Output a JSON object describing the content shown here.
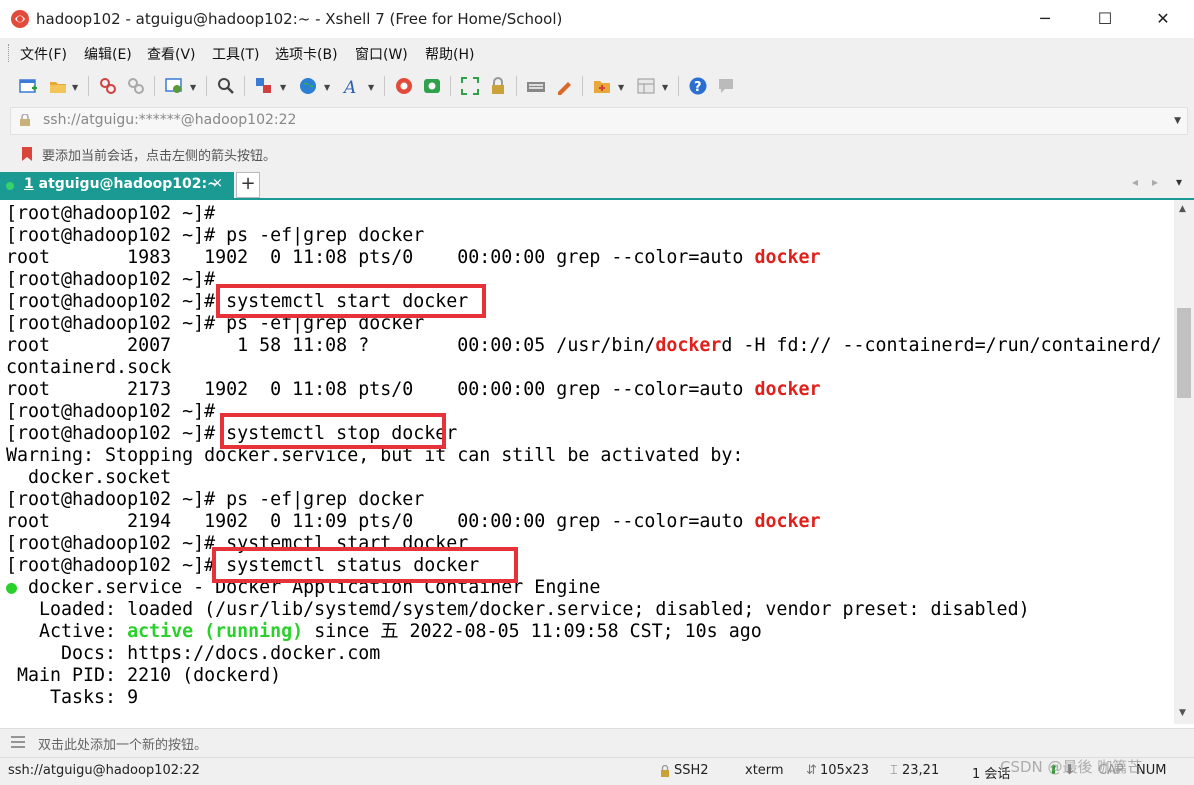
{
  "window": {
    "title": "hadoop102 - atguigu@hadoop102:~ - Xshell 7 (Free for Home/School)",
    "minimize": "─",
    "maximize": "☐",
    "close": "✕"
  },
  "menu": [
    "文件(F)",
    "编辑(E)",
    "查看(V)",
    "工具(T)",
    "选项卡(B)",
    "窗口(W)",
    "帮助(H)"
  ],
  "address": {
    "value": "ssh://atguigu:******@hadoop102:22"
  },
  "hint": "要添加当前会话，点击左侧的箭头按钮。",
  "tab": {
    "number": "1",
    "label": " atguigu@hadoop102:~",
    "close": "×",
    "add": "+",
    "nav_left": "◂",
    "nav_right": "▸",
    "nav_menu": "▾"
  },
  "terminal": {
    "lines": [
      [
        "[root@hadoop102 ~]#"
      ],
      [
        "[root@hadoop102 ~]# ps -ef|grep docker"
      ],
      [
        "root       1983   1902  0 11:08 pts/0    00:00:00 grep --color=auto ",
        {
          "t": "docker",
          "c": "red"
        }
      ],
      [
        "[root@hadoop102 ~]#"
      ],
      [
        "[root@hadoop102 ~]# systemctl start docker"
      ],
      [
        "[root@hadoop102 ~]# ps -ef|grep docker"
      ],
      [
        "root       2007      1 58 11:08 ?        00:00:05 /usr/bin/",
        {
          "t": "docker",
          "c": "red"
        },
        "d -H fd:// --containerd=/run/containerd/"
      ],
      [
        "containerd.sock"
      ],
      [
        "root       2173   1902  0 11:08 pts/0    00:00:00 grep --color=auto ",
        {
          "t": "docker",
          "c": "red"
        }
      ],
      [
        "[root@hadoop102 ~]#"
      ],
      [
        "[root@hadoop102 ~]# systemctl stop docker"
      ],
      [
        "Warning: Stopping docker.service, but it can still be activated by:"
      ],
      [
        "  docker.socket"
      ],
      [
        "[root@hadoop102 ~]# ps -ef|grep docker"
      ],
      [
        "root       2194   1902  0 11:09 pts/0    00:00:00 grep --color=auto ",
        {
          "t": "docker",
          "c": "red"
        }
      ],
      [
        "[root@hadoop102 ~]# systemctl start docker"
      ],
      [
        "[root@hadoop102 ~]# systemctl status docker"
      ],
      [
        {
          "t": "●",
          "c": "dot"
        },
        " docker.service - Docker Application Container Engine"
      ],
      [
        "   Loaded: loaded (/usr/lib/systemd/system/docker.service; disabled; vendor preset: disabled)"
      ],
      [
        "   Active: ",
        {
          "t": "active (running)",
          "c": "green"
        },
        " since 五 2022-08-05 11:09:58 CST; 10s ago"
      ],
      [
        "     Docs: https://docs.docker.com"
      ],
      [
        " Main PID: 2210 (dockerd)"
      ],
      [
        "    Tasks: 9"
      ]
    ]
  },
  "command_bar": "双击此处添加一个新的按钮。",
  "status": {
    "connection": "ssh://atguigu@hadoop102:22",
    "protocol": "SSH2",
    "term": "xterm",
    "size": "105x23",
    "cursor": "23,21",
    "sessions": "1 会话",
    "caps": "CAP",
    "num": "NUM"
  },
  "watermark": "CSDN @最後 咖篇芒",
  "colors": {
    "tab_accent": "#1a9a93",
    "highlight_red": "#e0201b",
    "active_green": "#2bd12b",
    "annotation_box": "#e8323a"
  }
}
